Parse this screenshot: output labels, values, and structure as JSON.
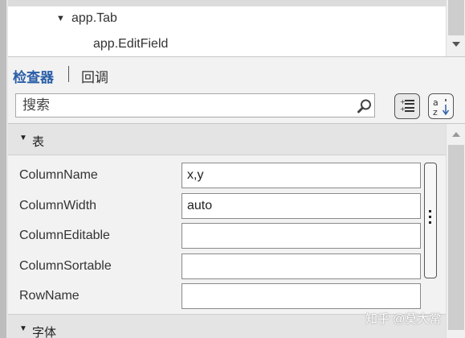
{
  "tree": {
    "items": [
      {
        "label": "app.Tab",
        "expanded": true
      },
      {
        "label": "app.EditField"
      }
    ]
  },
  "tabs": {
    "inspector": "检查器",
    "callback": "回调"
  },
  "search": {
    "placeholder": "搜索",
    "value": ""
  },
  "groups": [
    {
      "label": "表",
      "properties": [
        {
          "name": "ColumnName",
          "value": "x,y"
        },
        {
          "name": "ColumnWidth",
          "value": "auto"
        },
        {
          "name": "ColumnEditable",
          "value": ""
        },
        {
          "name": "ColumnSortable",
          "value": ""
        },
        {
          "name": "RowName",
          "value": ""
        }
      ]
    },
    {
      "label": "字体"
    }
  ],
  "watermark": "知乎 @莫大常",
  "colors": {
    "accent": "#2a5ea8",
    "selected_row": "#dcdcdc",
    "group_header": "#e4e4e4"
  },
  "icons": {
    "search": "magnifier-icon",
    "categorize": "list-view-icon",
    "sort": "sort-alpha-icon"
  }
}
